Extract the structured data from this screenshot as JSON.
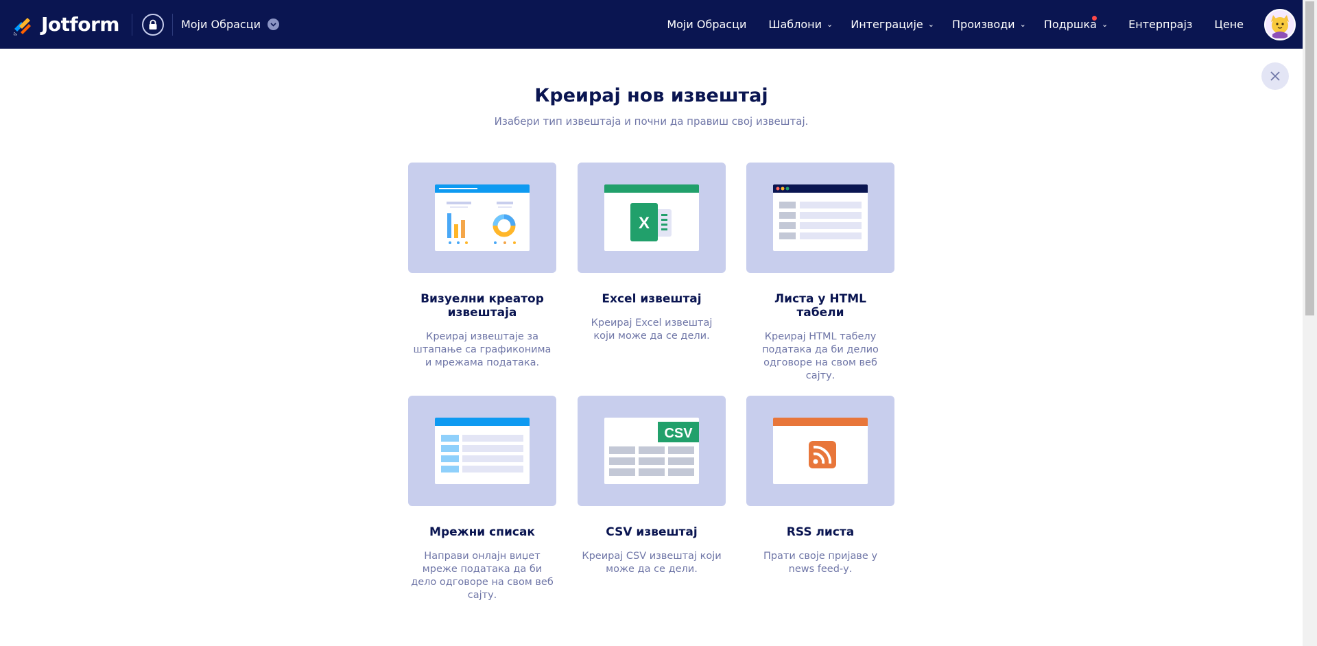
{
  "nav": {
    "brand": "Jotform",
    "workspace_label": "Моји Обрасци",
    "links": [
      {
        "label": "Моји Обрасци",
        "caret": false,
        "dot": false
      },
      {
        "label": "Шаблони",
        "caret": true,
        "dot": false
      },
      {
        "label": "Интеграције",
        "caret": true,
        "dot": false
      },
      {
        "label": "Производи",
        "caret": true,
        "dot": false
      },
      {
        "label": "Подршка",
        "caret": true,
        "dot": true
      },
      {
        "label": "Ентерпрајз",
        "caret": false,
        "dot": false
      },
      {
        "label": "Цене",
        "caret": false,
        "dot": false
      }
    ]
  },
  "header": {
    "title": "Креирај нов извештај",
    "subtitle": "Изабери тип извештаја и почни да правиш свој извештај."
  },
  "cards": [
    {
      "title": "Визуелни креатор извештаја",
      "desc": "Креирај извештаје за штапање са графиконима и мрежама података.",
      "icon": "visual-report-illustration"
    },
    {
      "title": "Excel извештај",
      "desc": "Креирај Excel извештај који може да се дели.",
      "icon": "excel-illustration"
    },
    {
      "title": "Листа у HTML табели",
      "desc": "Креирај HTML табелу података да би делио одговоре на свом веб сајту.",
      "icon": "html-table-illustration"
    },
    {
      "title": "Мрежни списак",
      "desc": "Направи онлајн виџет мреже података да би дело одговоре на свом веб сајту.",
      "icon": "grid-list-illustration"
    },
    {
      "title": "CSV извештај",
      "desc": "Креирај CSV извештај који може да се дели.",
      "icon": "csv-illustration",
      "badge": "CSV"
    },
    {
      "title": "RSS листа",
      "desc": "Прати своје пријаве у news feed-у.",
      "icon": "rss-illustration"
    }
  ],
  "colors": {
    "nav_bg": "#0a1551",
    "card_bg": "#c8ceed",
    "muted_text": "#6f76a7",
    "excel_green": "#21a06b",
    "rss_orange": "#e8763a",
    "blue_bar": "#0e9af1"
  }
}
